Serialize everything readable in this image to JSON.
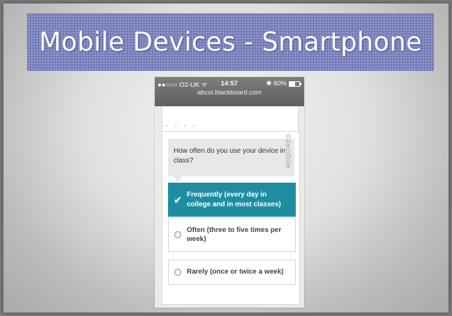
{
  "slide": {
    "title": "Mobile Devices - Smartphone"
  },
  "statusbar": {
    "carrier": "●●○○○ O2-UK ᯤ",
    "time": "14:57",
    "battery": "✱ 60%",
    "url": "abcol.blackboard.com"
  },
  "poll": {
    "question": "How often do you use your device in class?",
    "required_label": "REQUIRED",
    "options": [
      {
        "label": "Frequently (every day in college and in most classes)",
        "selected": true
      },
      {
        "label": "Often (three to five times per week)",
        "selected": false
      },
      {
        "label": "Rarely (once or twice a week)",
        "selected": false
      }
    ]
  },
  "colors": {
    "selected_option": "#1f8da1",
    "title_banner": "#8b93c8"
  }
}
